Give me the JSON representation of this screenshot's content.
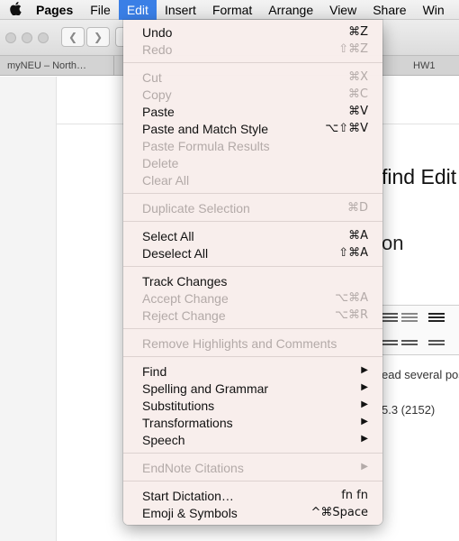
{
  "menubar": {
    "apple_icon": "",
    "items": [
      "Pages",
      "File",
      "Edit",
      "Insert",
      "Format",
      "Arrange",
      "View",
      "Share",
      "Win"
    ],
    "active": "Edit"
  },
  "tabs": [
    "myNEU – North…",
    "HW1"
  ],
  "content": {
    "heading1": "find Edit",
    "heading2": "on",
    "line1": "ead several pos",
    "line2": "5.3 (2152)"
  },
  "menu": {
    "undo": {
      "label": "Undo",
      "shortcut": "⌘Z"
    },
    "redo": {
      "label": "Redo",
      "shortcut": "⇧⌘Z"
    },
    "cut": {
      "label": "Cut",
      "shortcut": "⌘X"
    },
    "copy": {
      "label": "Copy",
      "shortcut": "⌘C"
    },
    "paste": {
      "label": "Paste",
      "shortcut": "⌘V"
    },
    "paste_match": {
      "label": "Paste and Match Style",
      "shortcut": "⌥⇧⌘V"
    },
    "paste_formula": {
      "label": "Paste Formula Results"
    },
    "delete": {
      "label": "Delete"
    },
    "clear_all": {
      "label": "Clear All"
    },
    "duplicate": {
      "label": "Duplicate Selection",
      "shortcut": "⌘D"
    },
    "select_all": {
      "label": "Select All",
      "shortcut": "⌘A"
    },
    "deselect_all": {
      "label": "Deselect All",
      "shortcut": "⇧⌘A"
    },
    "track_changes": {
      "label": "Track Changes"
    },
    "accept_change": {
      "label": "Accept Change",
      "shortcut": "⌥⌘A"
    },
    "reject_change": {
      "label": "Reject Change",
      "shortcut": "⌥⌘R"
    },
    "remove_highlights": {
      "label": "Remove Highlights and Comments"
    },
    "find": {
      "label": "Find"
    },
    "spelling": {
      "label": "Spelling and Grammar"
    },
    "substitutions": {
      "label": "Substitutions"
    },
    "transformations": {
      "label": "Transformations"
    },
    "speech": {
      "label": "Speech"
    },
    "endnote": {
      "label": "EndNote Citations"
    },
    "dictation": {
      "label": "Start Dictation…",
      "shortcut": "fn fn"
    },
    "emoji": {
      "label": "Emoji & Symbols",
      "shortcut": "^⌘Space"
    },
    "submenu_arrow": "▶"
  },
  "colors": {
    "menu_bg": "#f8eeec",
    "highlight": "#3a7fe6",
    "disabled_text": "#b3aaa8"
  }
}
